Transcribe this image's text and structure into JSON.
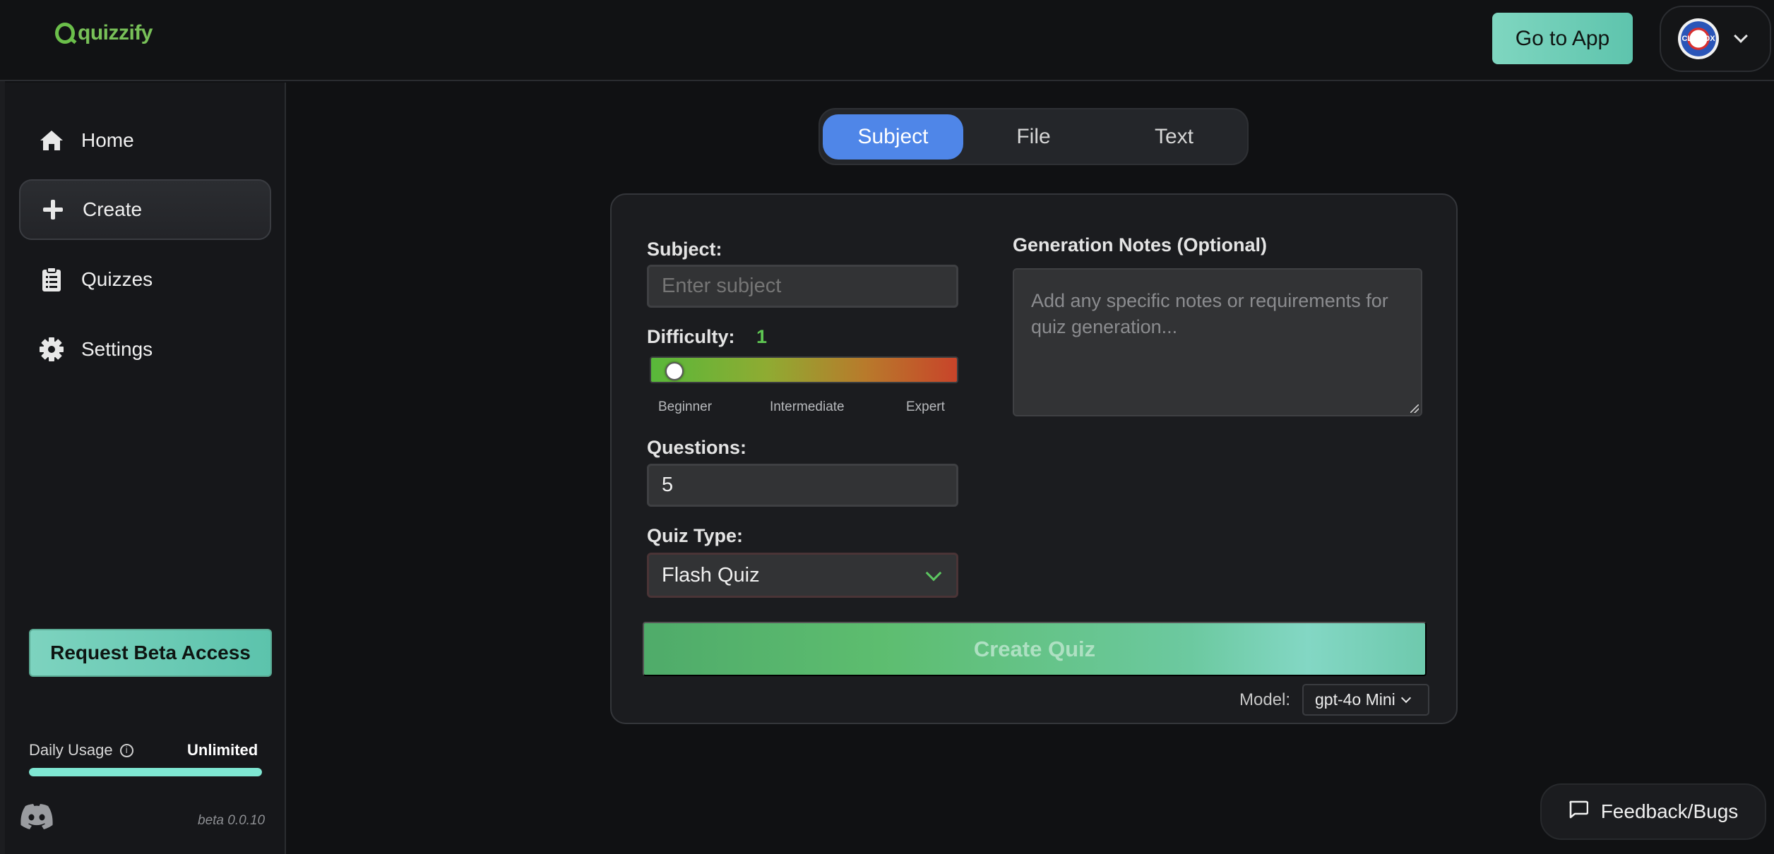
{
  "header": {
    "logo_text": "quizzify",
    "go_to_app_label": "Go to App",
    "avatar_text": "CLOROX"
  },
  "sidebar": {
    "items": [
      {
        "label": "Home",
        "icon": "home-icon"
      },
      {
        "label": "Create",
        "icon": "plus-icon",
        "active": true
      },
      {
        "label": "Quizzes",
        "icon": "clipboard-icon"
      },
      {
        "label": "Settings",
        "icon": "gear-icon"
      }
    ],
    "beta_button_label": "Request Beta Access",
    "daily_usage_label": "Daily Usage",
    "daily_usage_value": "Unlimited",
    "daily_usage_fraction": 1.0,
    "version": "beta 0.0.10"
  },
  "tabs": [
    {
      "label": "Subject",
      "active": true
    },
    {
      "label": "File"
    },
    {
      "label": "Text"
    }
  ],
  "form": {
    "subject_label": "Subject:",
    "subject_placeholder": "Enter subject",
    "difficulty_label": "Difficulty:",
    "difficulty_value": "1",
    "difficulty_ticks": [
      "Beginner",
      "Intermediate",
      "Expert"
    ],
    "questions_label": "Questions:",
    "questions_value": "5",
    "quiz_type_label": "Quiz Type:",
    "quiz_type_value": "Flash Quiz",
    "notes_label": "Generation Notes (Optional)",
    "notes_placeholder": "Add any specific notes or requirements for quiz generation...",
    "create_button_label": "Create Quiz",
    "model_label": "Model:",
    "model_value": "gpt-4o Mini"
  },
  "feedback_label": "Feedback/Bugs",
  "colors": {
    "accent_blue": "#4f86e8",
    "accent_teal": "#7dd3bf",
    "accent_green": "#5ec652"
  }
}
